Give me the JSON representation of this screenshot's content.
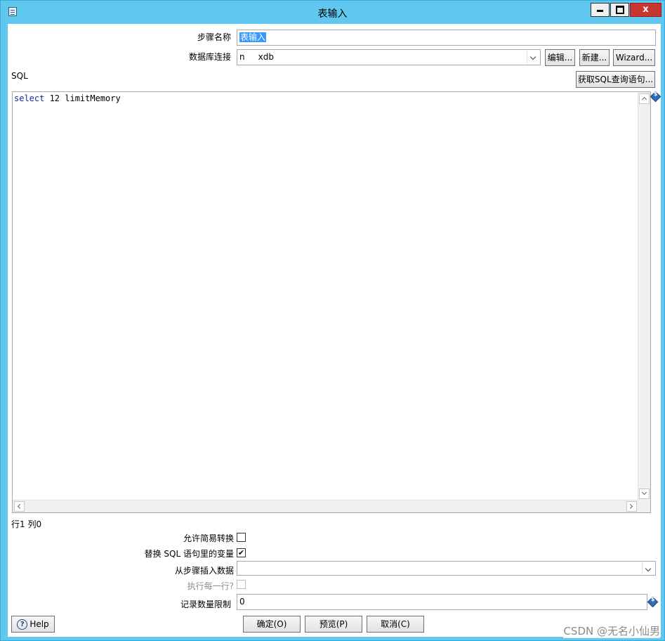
{
  "window": {
    "title": "表输入",
    "close_glyph": "x"
  },
  "form": {
    "step_name_label": "步骤名称",
    "step_name_value": "表输入",
    "db_conn_label": "数据库连接",
    "db_conn_value": "n     xdb",
    "edit_button": "编辑...",
    "new_button": "新建...",
    "wizard_button": "Wizard...",
    "sql_label": "SQL",
    "get_sql_button": "获取SQL查询语句...",
    "sql_keyword": "select",
    "sql_rest": " 12 limitMemory",
    "cursor_pos": "行1 列0",
    "lazy_conversion_label": "允许简易转换",
    "lazy_conversion_checked": false,
    "replace_vars_label": "替换 SQL 语句里的变量",
    "replace_vars_checked": true,
    "replace_vars_check_glyph": "✔",
    "insert_from_step_label": "从步骤插入数据",
    "insert_from_step_value": "",
    "execute_each_row_label": "执行每一行?",
    "execute_each_row_checked": false,
    "limit_label": "记录数量限制",
    "limit_value": "0",
    "variable_icon_glyph": "$"
  },
  "buttons": {
    "help": "Help",
    "help_glyph": "?",
    "ok": "确定(O)",
    "preview": "预览(P)",
    "cancel": "取消(C)"
  },
  "watermark": "CSDN @无名小仙男",
  "icons": {
    "window": "table-input-icon",
    "variable": "variable-dollar-icon",
    "help": "help-circle-icon"
  }
}
